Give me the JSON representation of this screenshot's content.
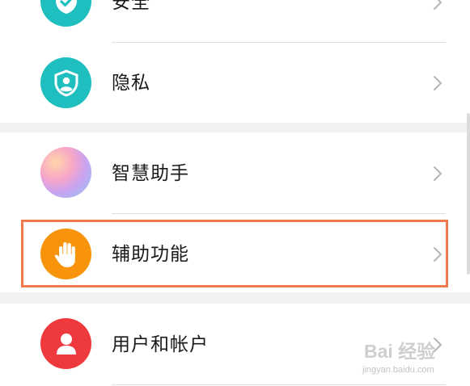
{
  "settings": {
    "items": [
      {
        "label": "安全",
        "icon": "shield-check-icon",
        "icon_color": "#1fbfbf"
      },
      {
        "label": "隐私",
        "icon": "shield-person-icon",
        "icon_color": "#1fbfbf"
      },
      {
        "label": "智慧助手",
        "icon": "smart-assistant-icon",
        "icon_color": "gradient"
      },
      {
        "label": "辅助功能",
        "icon": "hand-icon",
        "icon_color": "#f7940c"
      },
      {
        "label": "用户和帐户",
        "icon": "user-icon",
        "icon_color": "#ee3a3f"
      }
    ],
    "highlighted_item": "辅助功能",
    "highlight_color": "#ef7a4b"
  },
  "watermark": {
    "brand": "Bai 经验",
    "url": "jingyan.baidu.com"
  }
}
